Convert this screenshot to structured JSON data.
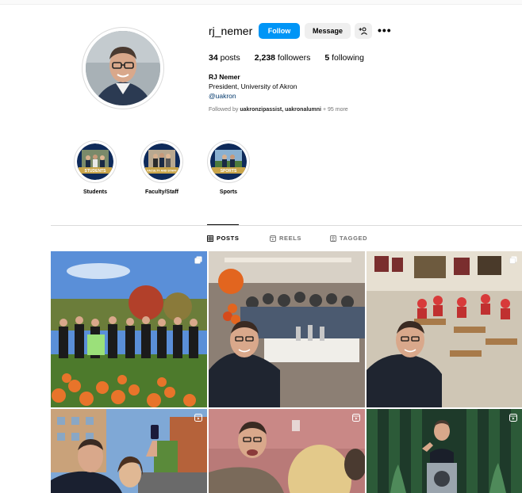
{
  "profile": {
    "username": "rj_nemer",
    "follow_label": "Follow",
    "message_label": "Message",
    "posts_count": "34",
    "posts_label": "posts",
    "followers_count": "2,238",
    "followers_label": "followers",
    "following_count": "5",
    "following_label": "following",
    "full_name": "RJ Nemer",
    "bio": "President, University of Akron",
    "handle_link": "@uakron",
    "followed_by_prefix": "Followed by",
    "followed_by_names": "uakronzipassist, uakronalumni",
    "followed_by_more": "+ 95 more"
  },
  "highlights": [
    {
      "label": "Students",
      "badge": "STUDENTS"
    },
    {
      "label": "Faculty/Staff",
      "badge": "FACULTY AND STAFF"
    },
    {
      "label": "Sports",
      "badge": "SPORTS"
    }
  ],
  "tabs": [
    {
      "label": "POSTS",
      "icon": "grid-icon",
      "active": true
    },
    {
      "label": "REELS",
      "icon": "reels-icon",
      "active": false
    },
    {
      "label": "TAGGED",
      "icon": "tagged-icon",
      "active": false
    }
  ],
  "colors": {
    "accent": "#0095f6",
    "link": "#00376b"
  }
}
